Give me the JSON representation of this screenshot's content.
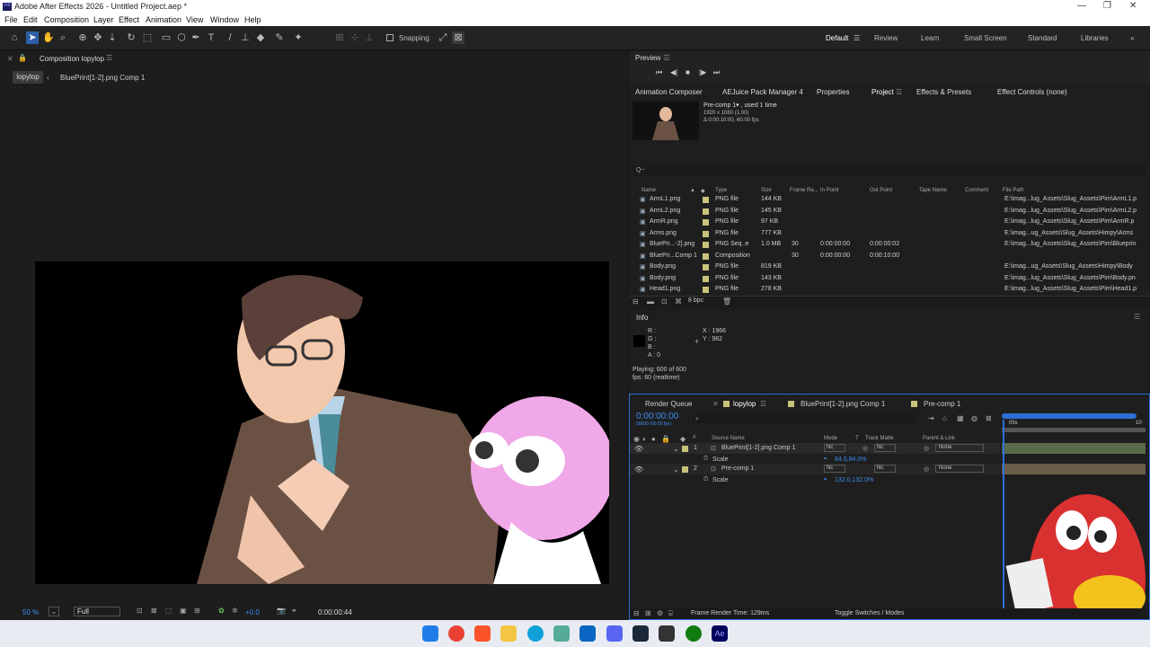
{
  "window": {
    "title": "Adobe After Effects 2026 - Untitled Project.aep *"
  },
  "menu": [
    "File",
    "Edit",
    "Composition",
    "Layer",
    "Effect",
    "Animation",
    "View",
    "Window",
    "Help"
  ],
  "toolbar": {
    "snapping": "Snapping"
  },
  "workspaces": [
    "Default",
    "Review",
    "Learn",
    "Small Screen",
    "Standard",
    "Libraries"
  ],
  "comp": {
    "panel_title": "Composition lopylop",
    "breadcrumb_active": "lopylop",
    "breadcrumb_next": "BluePrint[1-2].png Comp 1",
    "zoom": "50 %",
    "resolution": "Full",
    "exposure": "+0.0",
    "timecode": "0:00:00:44"
  },
  "preview": {
    "title": "Preview"
  },
  "project_tabs": [
    "Animation Composer",
    "AEJuice Pack Manager 4",
    "Properties",
    "Project",
    "Effects & Presets",
    "Effect Controls (none)"
  ],
  "project": {
    "item_name": "Pre-comp 1▾ , used 1 time",
    "item_res": "1920 x 1080 (1.00)",
    "item_dur": "Δ 0:00:10:00, 60.00 fps",
    "bpc": "8 bpc",
    "search_placeholder": "Q~",
    "columns": [
      "Name",
      "Type",
      "Size",
      "Frame Ra...",
      "In Point",
      "Out Point",
      "Tape Name",
      "Comment",
      "File Path"
    ],
    "rows": [
      {
        "name": "ArmL1.png",
        "type": "PNG file",
        "size": "144 KB",
        "fr": "",
        "in": "",
        "out": "",
        "path": "E:\\imag...lug_Assets\\Slug_Assets\\Pim\\ArmL1.p"
      },
      {
        "name": "ArmL2.png",
        "type": "PNG file",
        "size": "145 KB",
        "fr": "",
        "in": "",
        "out": "",
        "path": "E:\\imag...lug_Assets\\Slug_Assets\\Pim\\ArmL2.p"
      },
      {
        "name": "ArmR.png",
        "type": "PNG file",
        "size": "97 KB",
        "fr": "",
        "in": "",
        "out": "",
        "path": "E:\\imag...lug_Assets\\Slug_Assets\\Pim\\ArmR.p"
      },
      {
        "name": "Arms.png",
        "type": "PNG file",
        "size": "777 KB",
        "fr": "",
        "in": "",
        "out": "",
        "path": "E:\\imag...ug_Assets\\Slug_Assets\\Himpy\\Arms"
      },
      {
        "name": "BluePri...-2].png",
        "type": "PNG Seq..e",
        "size": "1.0 MB",
        "fr": "30",
        "in": "0:00:00:00",
        "out": "0:00:00:02",
        "path": "E:\\imag...lug_Assets\\Slug_Assets\\Pim\\Blueprin"
      },
      {
        "name": "BluePri...Comp 1",
        "type": "Composition",
        "size": "",
        "fr": "30",
        "in": "0:00:00:00",
        "out": "0:00:10:00",
        "path": ""
      },
      {
        "name": "Body.png",
        "type": "PNG file",
        "size": "819 KB",
        "fr": "",
        "in": "",
        "out": "",
        "path": "E:\\imag...ug_Assets\\Slug_Assets\\Himpy\\Body"
      },
      {
        "name": "Body.png",
        "type": "PNG file",
        "size": "143 KB",
        "fr": "",
        "in": "",
        "out": "",
        "path": "E:\\imag...lug_Assets\\Slug_Assets\\Pim\\Body.pn"
      },
      {
        "name": "Head1.png",
        "type": "PNG file",
        "size": "278 KB",
        "fr": "",
        "in": "",
        "out": "",
        "path": "E:\\imag...lug_Assets\\Slug_Assets\\Pim\\Head1.p"
      }
    ]
  },
  "info": {
    "title": "Info",
    "r": "R :",
    "g": "G :",
    "b": "B :",
    "a": "A : 0",
    "x": "X : 1966",
    "y": "Y : 982",
    "playing": "Playing: 600 of 600",
    "fps": "fps: 60 (realtime)"
  },
  "timeline": {
    "tabs": [
      "Render Queue",
      "lopylop",
      "BluePrint[1-2].png Comp 1",
      "Pre-comp 1"
    ],
    "timecode": "0:00:00:00",
    "subcode": "00000 (60.00 fps)",
    "ruler": [
      "05s",
      "10"
    ],
    "headers": [
      "Source Name",
      "Mode",
      "T",
      "Track Matte",
      "Parent & Link"
    ],
    "layers": [
      {
        "num": "1",
        "name": "BluePrint[1-2].png Comp 1",
        "mode": "Nc",
        "matte": "Nc",
        "parent": "None",
        "prop": "Scale",
        "val": "84.0,84.0%"
      },
      {
        "num": "2",
        "name": "Pre-comp 1",
        "mode": "Nc",
        "matte": "Nc",
        "parent": "None",
        "prop": "Scale",
        "val": "132.0,132.0%"
      }
    ],
    "render_time": "Frame Render Time: 129ms",
    "toggle": "Toggle Switches / Modes"
  }
}
